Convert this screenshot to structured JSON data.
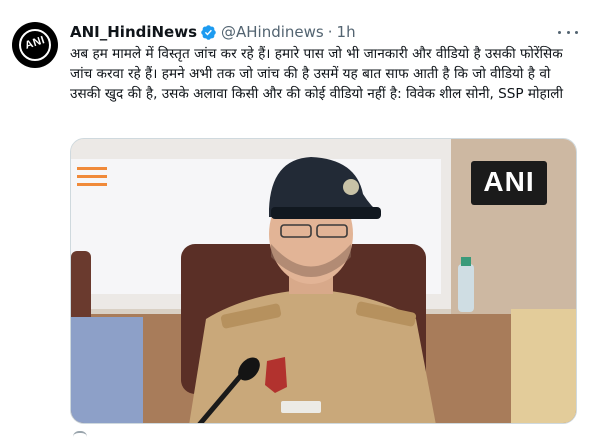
{
  "tweet": {
    "display_name": "ANI_HindiNews",
    "handle": "@AHindinews",
    "separator": "·",
    "time": "1h",
    "text": "अब हम मामले में विस्तृत जांच कर रहे हैं। हमारे पास जो भी जानकारी और वीडियो है उसकी फोरेंसिक जांच करवा रहे हैं। हमने अभी तक जो जांच की है उसमें यह बात साफ आती है कि जो वीडियो है वो उसकी खुद की है, उसके अलावा किसी और की कोई वीडियो नहीं है: विवेक शील सोनी, SSP मोहाली"
  },
  "avatar": {
    "logo_text": "ANI"
  },
  "media": {
    "watermark": "ANI"
  },
  "colors": {
    "verified_blue": "#1d9bf0",
    "muted_text": "#536471",
    "border": "#cfd9de"
  },
  "icons": [
    "verified-badge-icon",
    "more-options-icon",
    "reply-icon"
  ]
}
